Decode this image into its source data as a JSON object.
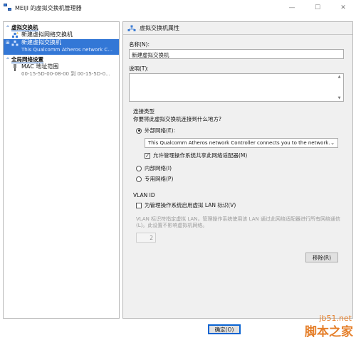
{
  "window": {
    "title": "MEIJI 的虚拟交换机管理器",
    "min": "—",
    "max": "☐",
    "close": "✕"
  },
  "left": {
    "section1": "虚拟交换机",
    "new_network_switch": "新建虚拟网络交换机",
    "selected_item": {
      "title": "新建虚拟交换机",
      "subtitle": "This Qualcomm Atheros network C..."
    },
    "section2": "全局网络设置",
    "mac_item": {
      "title": "MAC 地址范围",
      "subtitle": "00-15-5D-00-08-00 到 00-15-5D-0..."
    }
  },
  "right": {
    "header": "虚拟交换机属性",
    "name_label": "名称(N):",
    "name_value": "新建虚拟交换机",
    "notes_label": "说明(T):",
    "conn_type_title": "连接类型",
    "conn_question": "你要将此虚拟交换机连接到什么地方?",
    "external_label": "外部网络(E):",
    "adapter_selected": "This Qualcomm Atheros network Controller connects you to the network.",
    "allow_mgmt": "允许管理操作系统共享此网络适配器(M)",
    "internal_label": "内部网络(I)",
    "private_label": "专用网络(P)",
    "vlan_title": "VLAN ID",
    "vlan_checkbox": "为管理操作系统启用虚拟 LAN 标识(V)",
    "vlan_note": "VLAN 标识符指定虚拟 LAN，管理操作系统使用该 LAN 通过此网络适配器进行所有网络通信(L)。此设置不影响虚拟机网络。",
    "vlan_value": "2",
    "remove_button": "移除(R)"
  },
  "footer": {
    "ok_button": "确定(O)"
  },
  "watermark": {
    "site": "jb51.net",
    "brand": "脚本之家"
  }
}
